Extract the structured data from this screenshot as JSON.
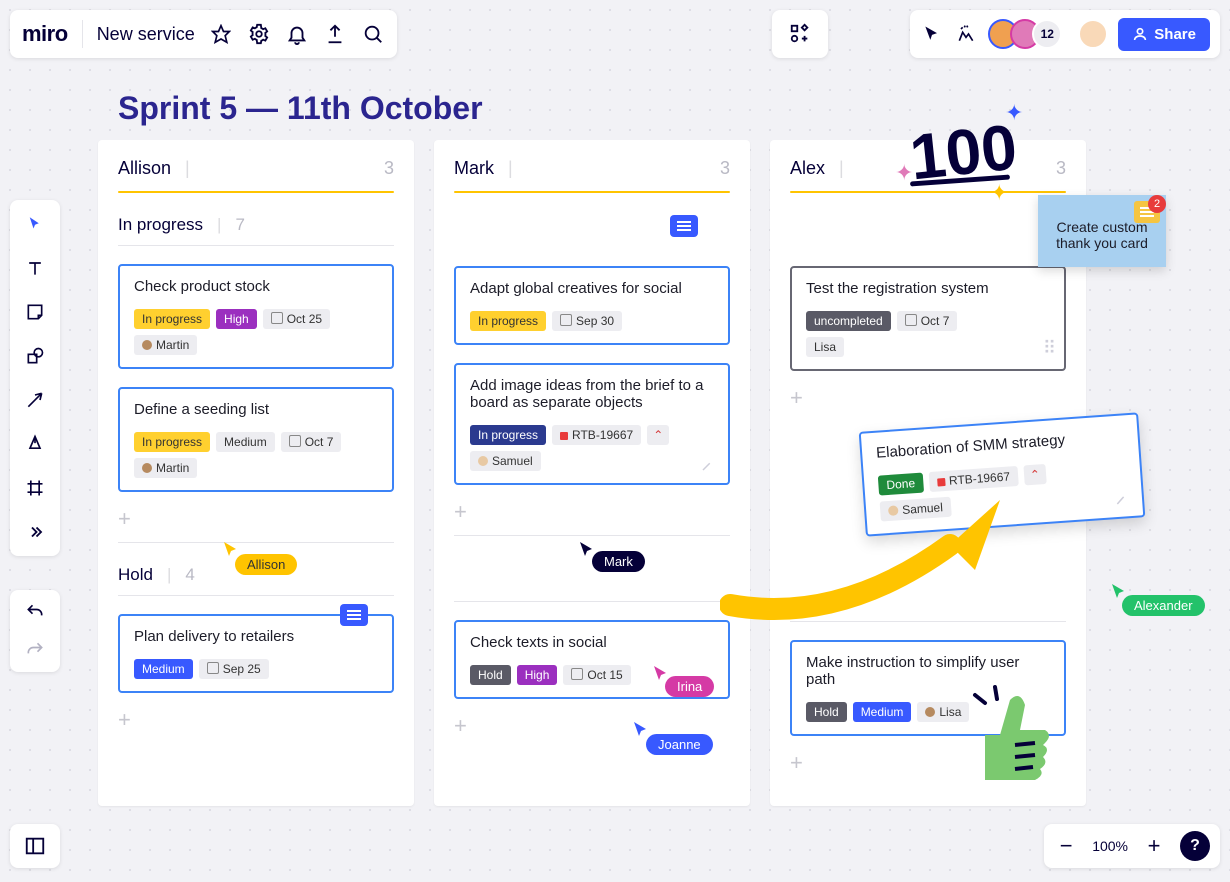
{
  "header": {
    "logo": "miro",
    "board_name": "New service",
    "user_count": "12",
    "share_label": "Share"
  },
  "board": {
    "title": "Sprint 5 — 11th October"
  },
  "columns": [
    {
      "owner": "Allison",
      "count": "3"
    },
    {
      "owner": "Mark",
      "count": "3"
    },
    {
      "owner": "Alex",
      "count": "3"
    }
  ],
  "sections": {
    "in_progress": {
      "label": "In progress",
      "count": "7"
    },
    "hold": {
      "label": "Hold",
      "count": "4"
    }
  },
  "cards": {
    "a1": {
      "title": "Check product stock",
      "status": "In progress",
      "priority": "High",
      "date": "Oct 25",
      "user": "Martin"
    },
    "a2": {
      "title": "Define a seeding list",
      "status": "In progress",
      "priority": "Medium",
      "date": "Oct 7",
      "user": "Martin"
    },
    "a3": {
      "title": "Plan delivery to retailers",
      "priority": "Medium",
      "date": "Sep 25"
    },
    "m1": {
      "title": "Adapt global creatives for social",
      "status": "In progress",
      "date": "Sep 30"
    },
    "m2": {
      "title": "Add image ideas from the brief to a board as separate objects",
      "status": "In progress",
      "ticket": "RTB-19667",
      "user": "Samuel"
    },
    "m3": {
      "title": "Check texts in social",
      "status": "Hold",
      "priority": "High",
      "date": "Oct 15"
    },
    "x1": {
      "title": "Test the registration system",
      "status": "uncompleted",
      "date": "Oct 7",
      "user": "Lisa"
    },
    "x2": {
      "title": "Make instruction to simplify user path",
      "status": "Hold",
      "priority": "Medium",
      "user": "Lisa"
    },
    "float": {
      "title": "Elaboration of SMM strategy",
      "status": "Done",
      "ticket": "RTB-19667",
      "user": "Samuel"
    }
  },
  "sticky": {
    "text": "Create custom thank you card",
    "comments": "2"
  },
  "cursors": {
    "allison": "Allison",
    "mark": "Mark",
    "irina": "Irina",
    "joanne": "Joanne",
    "alexander": "Alexander"
  },
  "zoom": {
    "level": "100%"
  },
  "colors": {
    "accent": "#3859FF",
    "cursor_allison": "#FFC400",
    "cursor_mark": "#050038",
    "cursor_irina": "#D53AA5",
    "cursor_joanne": "#3859FF",
    "cursor_alexander": "#23C26A"
  }
}
